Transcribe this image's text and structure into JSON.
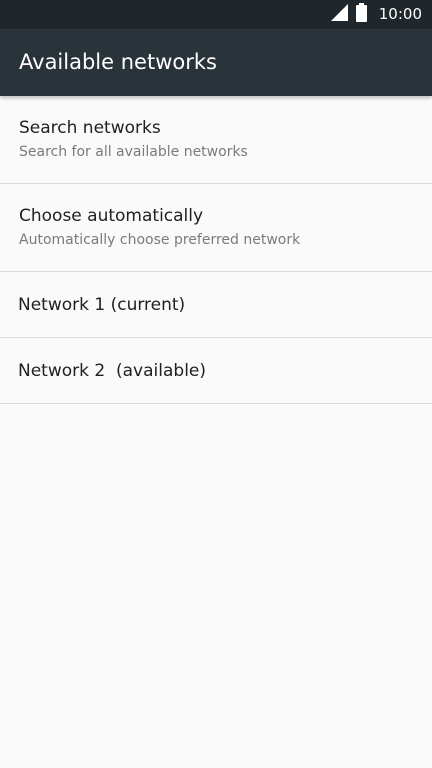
{
  "status_bar": {
    "time": "10:00",
    "icons": [
      "signal-icon",
      "battery-icon"
    ]
  },
  "app_bar": {
    "title": "Available networks"
  },
  "list": {
    "items": [
      {
        "title": "Search networks",
        "subtitle": "Search for all available networks"
      },
      {
        "title": "Choose automatically",
        "subtitle": "Automatically choose preferred network"
      },
      {
        "title": "Network 1 (current)"
      },
      {
        "title": "Network 2  (available)"
      }
    ]
  },
  "colors": {
    "status_bar": "#1f272c",
    "app_bar": "#29343a",
    "background": "#fafafa",
    "divider": "#dcdcdc"
  }
}
